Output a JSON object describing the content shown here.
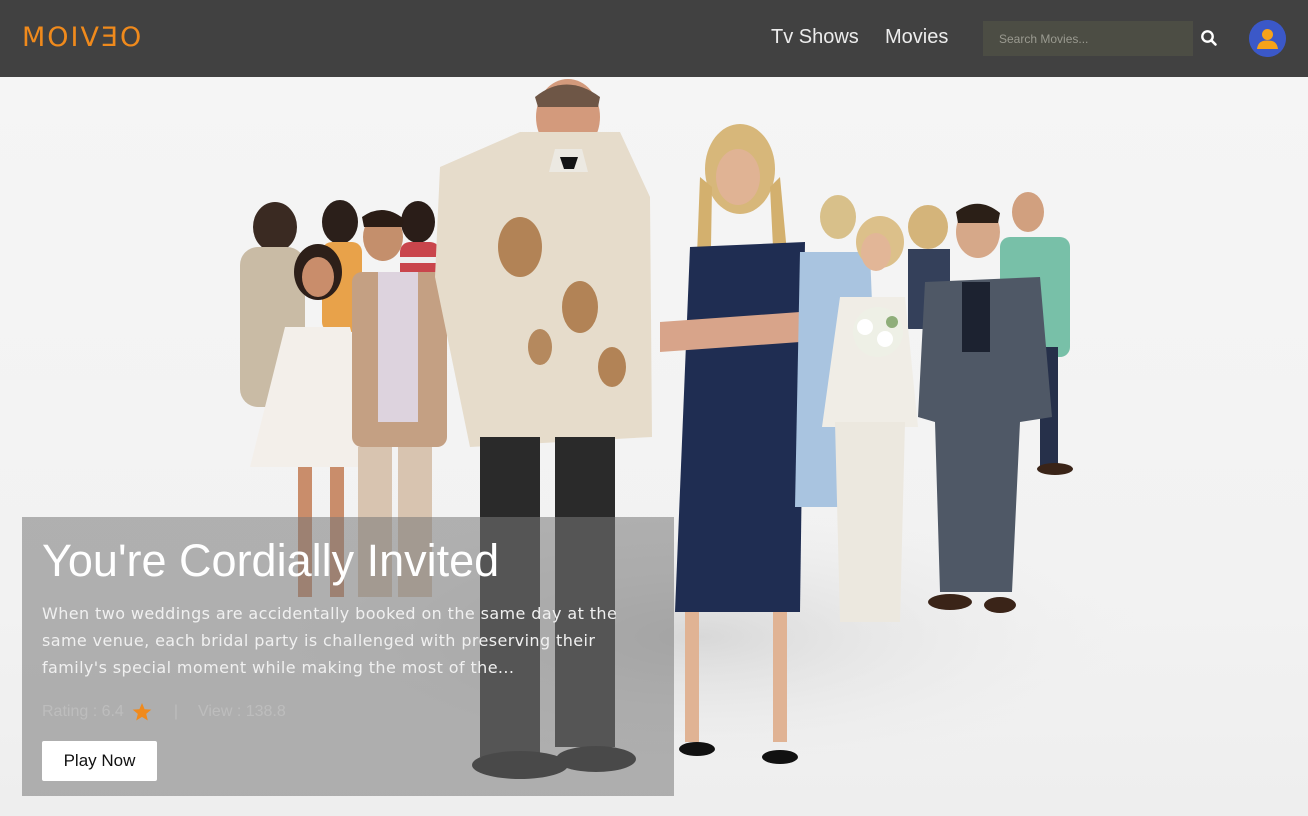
{
  "header": {
    "logo": "MOIVƎO",
    "nav": [
      {
        "label": "Tv Shows"
      },
      {
        "label": "Movies"
      }
    ],
    "search": {
      "placeholder": "Search Movies...",
      "value": ""
    },
    "icons": {
      "search": "search-icon",
      "profile": "user-avatar-icon"
    }
  },
  "hero": {
    "title": "You're Cordially Invited",
    "description": "When two weddings are accidentally booked on the same day at the same venue, each bridal party is challenged with preserving their family's special moment while making the most of the...",
    "rating_label": "Rating : 6.4",
    "separator": "|",
    "views_label": "View : 138.8",
    "play_label": "Play Now"
  },
  "colors": {
    "brand": "#f08a1c",
    "navbar": "#414141",
    "star": "#f08a1c"
  }
}
